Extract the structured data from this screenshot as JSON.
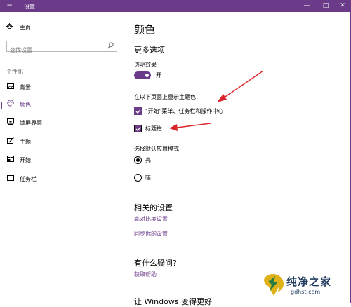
{
  "window": {
    "title": "设置",
    "back_glyph": "←",
    "minimize_glyph": "—",
    "maximize_glyph": "□",
    "close_glyph": "✕"
  },
  "sidebar": {
    "home_label": "主页",
    "search_placeholder": "查找设置",
    "section_label": "个性化",
    "items": [
      {
        "label": "背景",
        "icon": "image-icon"
      },
      {
        "label": "颜色",
        "icon": "palette-icon",
        "active": true
      },
      {
        "label": "锁屏界面",
        "icon": "lock-screen-icon"
      },
      {
        "label": "主题",
        "icon": "theme-brush-icon"
      },
      {
        "label": "开始",
        "icon": "start-menu-icon"
      },
      {
        "label": "任务栏",
        "icon": "taskbar-icon"
      }
    ]
  },
  "main": {
    "title": "颜色",
    "more_options": "更多选项",
    "transparency": {
      "label": "透明效果",
      "state_label": "开",
      "on": true
    },
    "accent_surfaces": {
      "label": "在以下页面上显示主题色",
      "options": [
        {
          "label": "\"开始\"菜单、任务栏和操作中心",
          "checked": true
        },
        {
          "label": "标题栏",
          "checked": true
        }
      ]
    },
    "app_mode": {
      "label": "选择默认应用模式",
      "options": [
        {
          "label": "亮",
          "selected": true
        },
        {
          "label": "暗",
          "selected": false
        }
      ]
    },
    "related": {
      "title": "相关的设置",
      "links": [
        "高对比度设置",
        "同步你的设置"
      ]
    },
    "questions": {
      "title": "有什么疑问?",
      "link": "获取帮助"
    },
    "improve": {
      "title": "让 Windows 变得更好"
    }
  },
  "watermark": {
    "name": "纯净之家",
    "url": "gdhst.com"
  },
  "colors": {
    "accent": "#6b3b8a",
    "annotation_arrow": "#d9262c"
  }
}
